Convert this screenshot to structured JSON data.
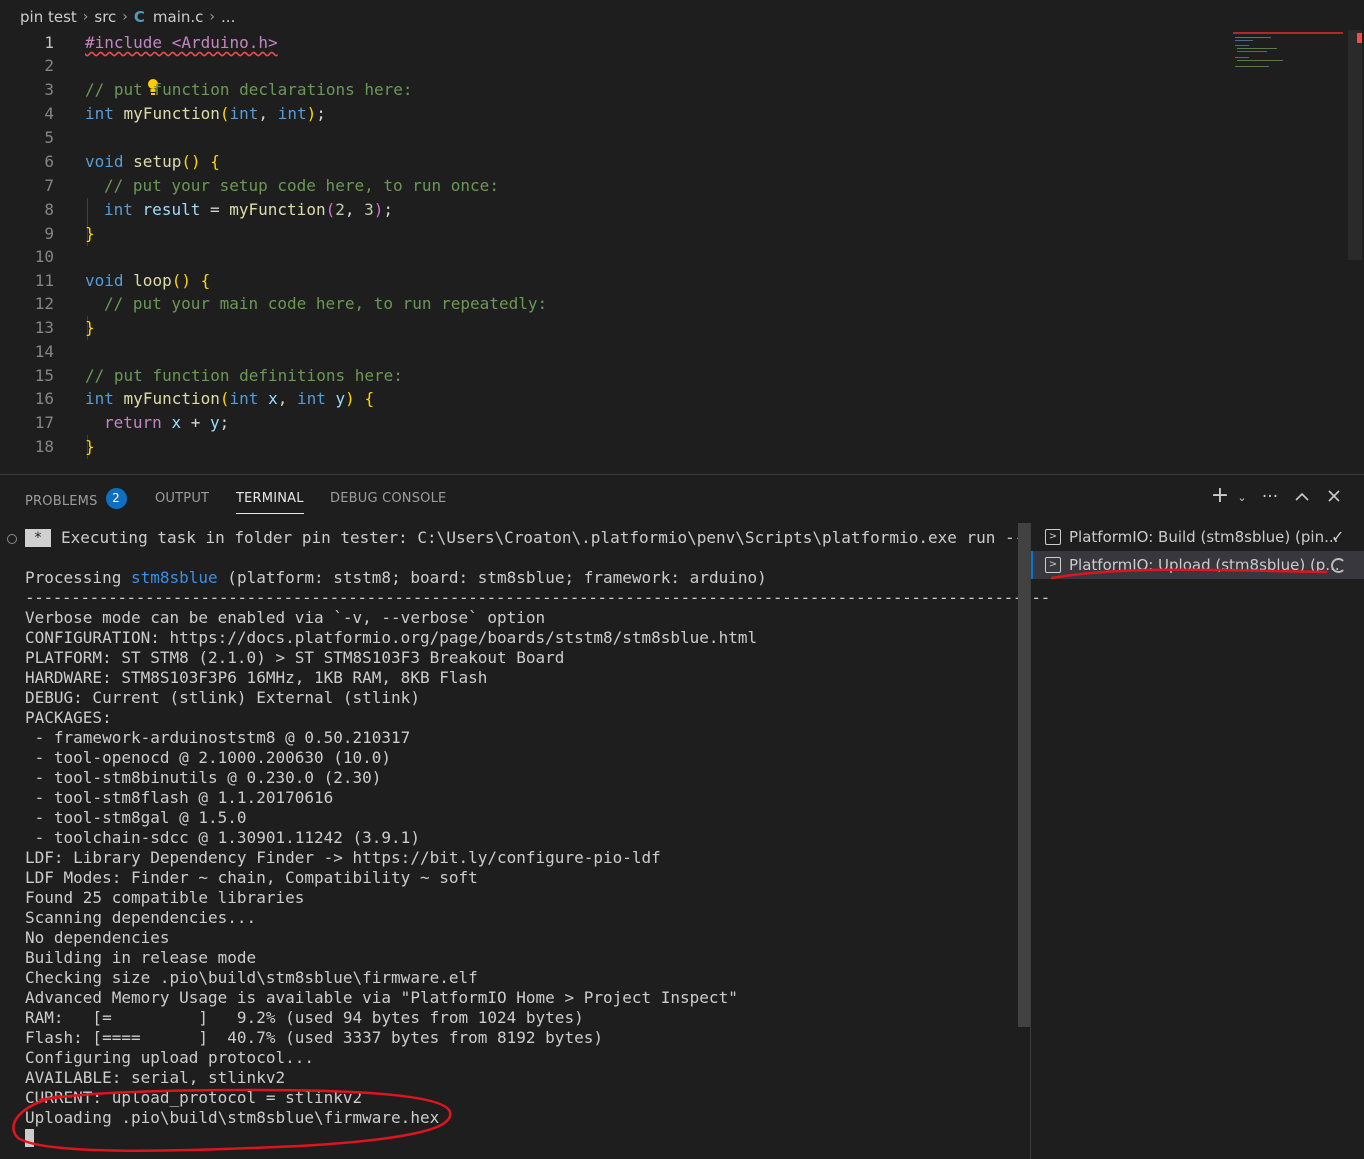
{
  "breadcrumb": {
    "folder": "pin test",
    "subfolder": "src",
    "file": "main.c",
    "more": "..."
  },
  "editor": {
    "lines": [
      {
        "n": "1"
      },
      {
        "n": "2"
      },
      {
        "n": "3"
      },
      {
        "n": "4"
      },
      {
        "n": "5"
      },
      {
        "n": "6"
      },
      {
        "n": "7"
      },
      {
        "n": "8"
      },
      {
        "n": "9"
      },
      {
        "n": "10"
      },
      {
        "n": "11"
      },
      {
        "n": "12"
      },
      {
        "n": "13"
      },
      {
        "n": "14"
      },
      {
        "n": "15"
      },
      {
        "n": "16"
      },
      {
        "n": "17"
      },
      {
        "n": "18"
      }
    ],
    "t": {
      "include": "#include <Arduino.h>",
      "c1": "// put function declarations here:",
      "int": "int",
      "myFunction": "myFunction",
      "void": "void",
      "setup": "setup",
      "c2": "// put your setup code here, to run once:",
      "result": "result",
      "n2": "2",
      "n3": "3",
      "loop": "loop",
      "c3": "// put your main code here, to run repeatedly:",
      "c4": "// put function definitions here:",
      "x": "x",
      "y": "y",
      "ret": "return"
    }
  },
  "panel": {
    "tabs": {
      "problems": "PROBLEMS",
      "problems_count": "2",
      "output": "OUTPUT",
      "terminal": "TERMINAL",
      "debug": "DEBUG CONSOLE"
    },
    "terminal": {
      "task_marker": "*",
      "executing": "Executing task in folder pin tester: C:\\Users\\Croaton\\.platformio\\penv\\Scripts\\platformio.exe run --",
      "processing_pre": "Processing ",
      "processing_env": "stm8sblue",
      "processing_post": " (platform: ststm8; board: stm8sblue; framework: arduino)",
      "separator": "---------------------------------------------------------------------------------------------------------------",
      "lines": [
        "Verbose mode can be enabled via `-v, --verbose` option",
        "CONFIGURATION: https://docs.platformio.org/page/boards/ststm8/stm8sblue.html",
        "PLATFORM: ST STM8 (2.1.0) > ST STM8S103F3 Breakout Board",
        "HARDWARE: STM8S103F3P6 16MHz, 1KB RAM, 8KB Flash",
        "DEBUG: Current (stlink) External (stlink)",
        "PACKAGES:",
        " - framework-arduinoststm8 @ 0.50.210317",
        " - tool-openocd @ 2.1000.200630 (10.0)",
        " - tool-stm8binutils @ 0.230.0 (2.30)",
        " - tool-stm8flash @ 1.1.20170616",
        " - tool-stm8gal @ 1.5.0",
        " - toolchain-sdcc @ 1.30901.11242 (3.9.1)",
        "LDF: Library Dependency Finder -> https://bit.ly/configure-pio-ldf",
        "LDF Modes: Finder ~ chain, Compatibility ~ soft",
        "Found 25 compatible libraries",
        "Scanning dependencies...",
        "No dependencies",
        "Building in release mode",
        "Checking size .pio\\build\\stm8sblue\\firmware.elf",
        "Advanced Memory Usage is available via \"PlatformIO Home > Project Inspect\"",
        "RAM:   [=         ]   9.2% (used 94 bytes from 1024 bytes)",
        "Flash: [====      ]  40.7% (used 3337 bytes from 8192 bytes)",
        "Configuring upload protocol...",
        "AVAILABLE: serial, stlinkv2",
        "CURRENT: upload_protocol = stlinkv2",
        "Uploading .pio\\build\\stm8sblue\\firmware.hex"
      ]
    },
    "tasks": [
      {
        "label": "PlatformIO: Build (stm8sblue) (pin...",
        "status": "done"
      },
      {
        "label": "PlatformIO: Upload (stm8sblue) (p...",
        "status": "running"
      }
    ]
  },
  "colors": {
    "background": "#1e1e1e",
    "keyword": "#569cd6",
    "function": "#dcdcaa",
    "comment": "#6a9955",
    "badge": "#0e70c0",
    "annotation": "#e0141e"
  }
}
